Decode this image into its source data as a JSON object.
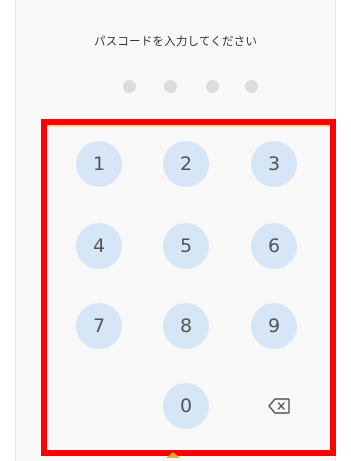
{
  "passcode": {
    "prompt": "パスコードを入力してください",
    "entered_digits": 0,
    "max_digits": 4
  },
  "keypad": {
    "keys": [
      "1",
      "2",
      "3",
      "4",
      "5",
      "6",
      "7",
      "8",
      "9",
      "0"
    ],
    "delete_icon": "backspace-icon"
  },
  "colors": {
    "key_background": "#d6e6f7",
    "key_text": "#555555",
    "dot_empty": "#dcdcdc",
    "highlight": "#ff0000"
  }
}
